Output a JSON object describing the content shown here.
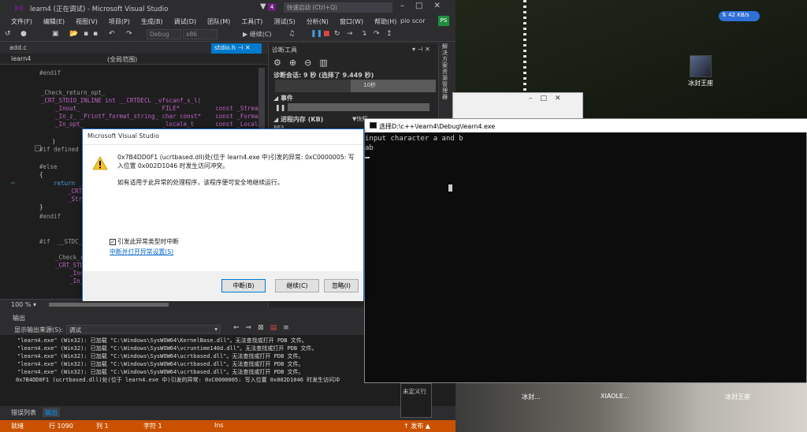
{
  "vs": {
    "title": "learn4 (正在调试) - Microsoft Visual Studio",
    "quick_launch": "快速启动 (Ctrl+Q)",
    "notification_count": "4",
    "user": "pio scor",
    "user_badge": "PS",
    "menus": [
      "文件(F)",
      "编辑(E)",
      "视图(V)",
      "项目(P)",
      "生成(B)",
      "调试(D)",
      "团队(M)",
      "工具(T)",
      "测试(S)",
      "分析(N)",
      "窗口(W)",
      "帮助(H)"
    ],
    "toolbar": {
      "config": "Debug",
      "platform": "x86",
      "continue": "继续(C)"
    },
    "tabs": {
      "file1": "add.c",
      "file2": "stdio.h"
    },
    "nav": {
      "project": "learn4",
      "scope": "(全局范围)"
    },
    "zoom": "100 %"
  },
  "editor_lines": [
    "#endif",
    "_Check_return_opt_",
    "_CRT_STDIO_INLINE int __CRTDECL _vfscanf_s_l(",
    "    _Inout_                       FILE*          const _Stream,",
    "    _In_z_ _Printf_format_string_ char const*    const _Format,",
    "    _In_opt_                      _locale_t      const _Locale,",
    ")",
    "#if defined _",
    "#else",
    "{",
    "    return _",
    "        _CRT_",
    "        _Stre",
    "}",
    "#endif",
    "#if  __STDC_WA",
    "    _Check_re",
    "    _CRT_STDI",
    "        _Inou",
    "        _In_z"
  ],
  "diag": {
    "title": "诊断工具",
    "session": "诊断会话: 9 秒 (选择了 9.449 秒)",
    "timeline_label": "10秒",
    "events": "事件",
    "memory": "进程内存 (KB)",
    "snapshot": "▼快照",
    "mem_value": "863"
  },
  "side_strip": "解决方案资源管理器",
  "output": {
    "header": "输出",
    "source_label": "显示输出来源(S):",
    "source_value": "调试",
    "lines": [
      "\"learn4.exe\" (Win32): 已加载 \"C:\\Windows\\SysWOW64\\KernelBase.dll\"。无法查找或打开 PDB 文件。",
      "\"learn4.exe\" (Win32): 已加载 \"C:\\Windows\\SysWOW64\\vcruntime140d.dll\"。无法查找或打开 PDB 文件。",
      "\"learn4.exe\" (Win32): 已加载 \"C:\\Windows\\SysWOW64\\ucrtbased.dll\"。无法查找或打开 PDB 文件。",
      "\"learn4.exe\" (Win32): 已加载 \"C:\\Windows\\SysWOW64\\ucrtbased.dll\"。无法查找或打开 PDB 文件。",
      "\"learn4.exe\" (Win32): 已加载 \"C:\\Windows\\SysWOW64\\ucrtbased.dll\"。无法查找或打开 PDB 文件。",
      "0x7B4DD0F1 (ucrtbased.dll)处(位于 learn4.exe 中)引发的异常: 0xC0000005: 写入位置 0x002D1046 时发生访问冲"
    ],
    "tab_errors": "错误列表",
    "tab_output": "输出"
  },
  "status": {
    "ready": "就绪",
    "line": "行 1090",
    "col": "列 1",
    "char": "字符 1",
    "ins": "Ins",
    "publish": "↑ 发布 ▲"
  },
  "undefined_box": "未定义行",
  "console": {
    "title": "选择D:\\c++\\learn4\\Debug\\learn4.exe",
    "lines": [
      "input character a and b",
      "ab"
    ]
  },
  "dialog": {
    "title": "Microsoft Visual Studio",
    "message": "0x7B4DD0F1 (ucrtbased.dll)处(位于 learn4.exe 中)引发的异常: 0xC0000005: 写入位置 0x002D1046 时发生访问冲突。",
    "hint": "如有适用于此异常的处理程序，该程序便可安全地继续运行。",
    "checkbox_label": "引发此异常类型时中断",
    "checkbox_checked": true,
    "link": "中断并打开异常设置(S)",
    "buttons": {
      "break": "中断(B)",
      "continue": "继续(C)",
      "ignore": "忽略(I)"
    }
  },
  "desktop": {
    "network": "42 KB/s",
    "icon_label": "冰封王座",
    "thumb_labels": [
      "冰封...",
      "XIAOLE...",
      "冰封王座"
    ]
  }
}
